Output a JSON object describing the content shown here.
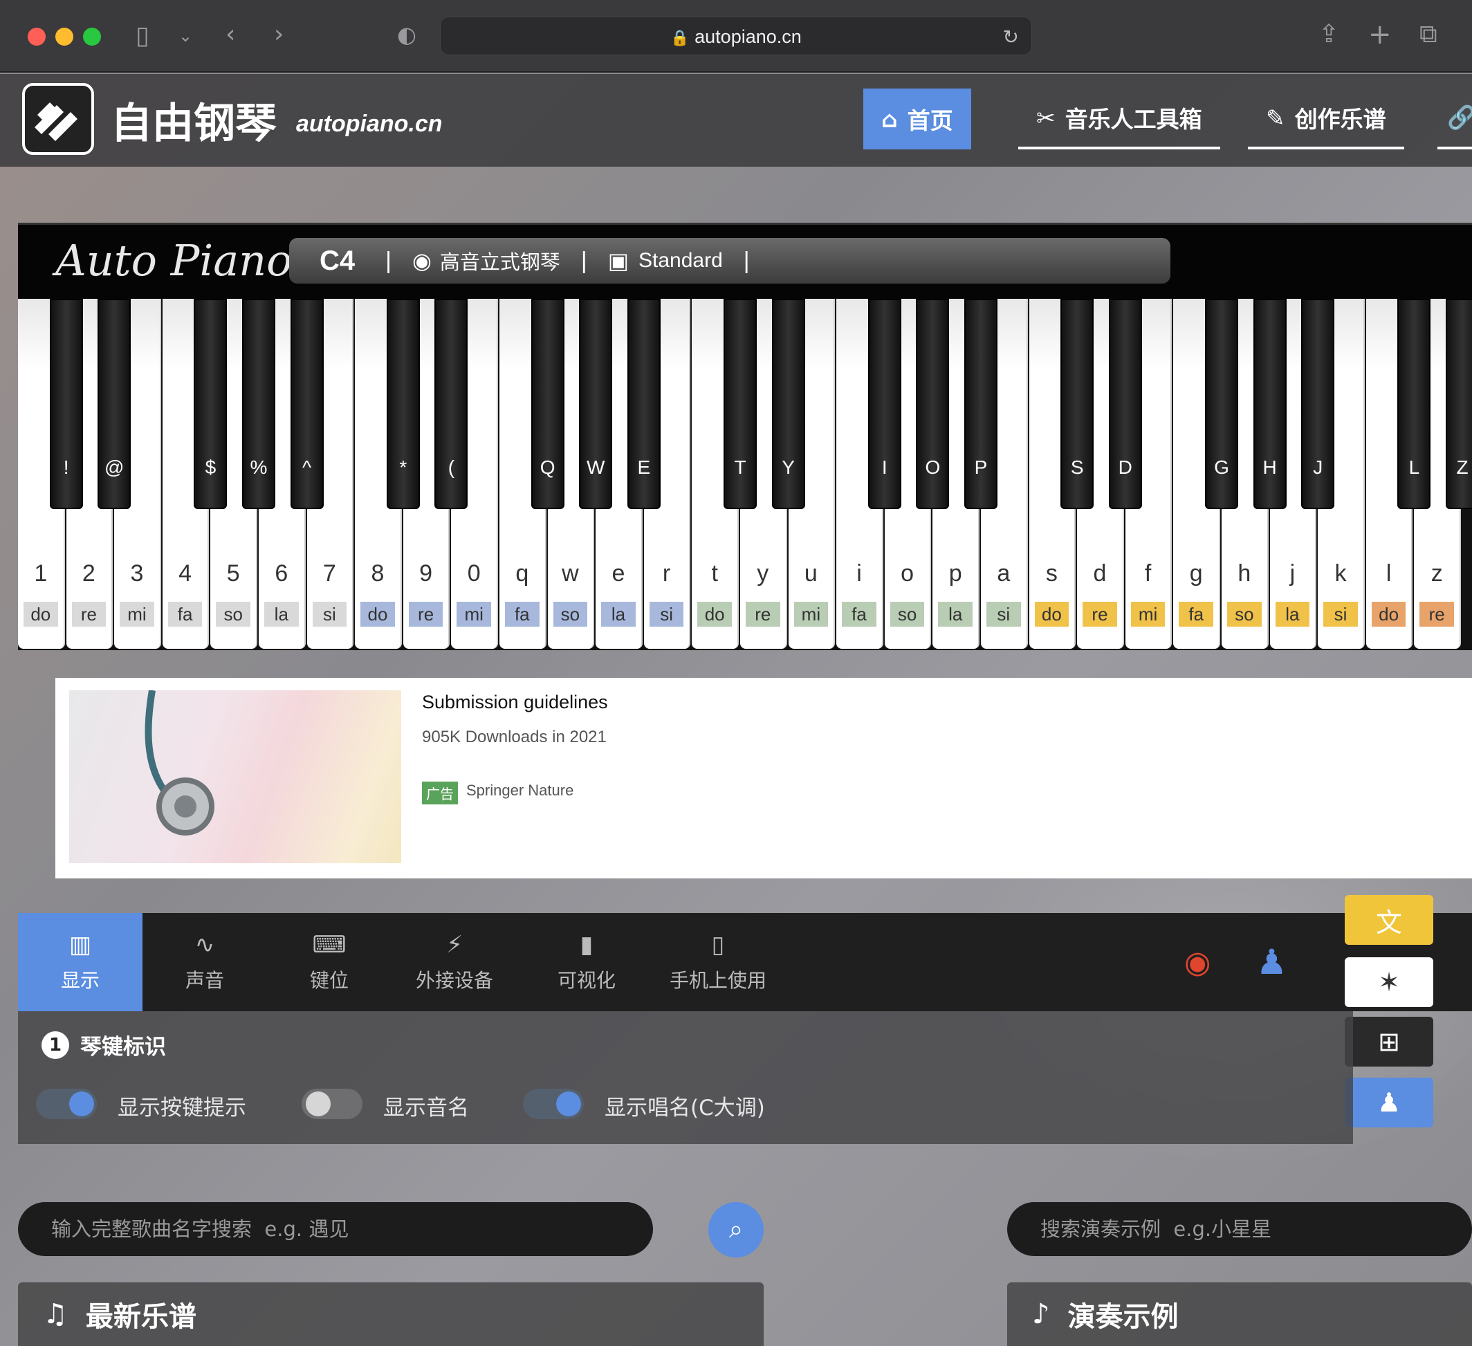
{
  "browser": {
    "url": "autopiano.cn"
  },
  "header": {
    "brand": "自由钢琴",
    "brand_sub": "autopiano.cn",
    "nav": [
      {
        "label": "首页",
        "icon": "home-icon"
      },
      {
        "label": "音乐人工具箱",
        "icon": "tools-icon"
      },
      {
        "label": "创作乐谱",
        "icon": "compose-icon"
      }
    ]
  },
  "piano": {
    "logo": "Auto Piano",
    "octave": "C4",
    "separator": "|",
    "instrument": "高音立式钢琴",
    "layout": "Standard",
    "white_keys": [
      {
        "k": "1",
        "s": "do",
        "c": "#d9d9d9"
      },
      {
        "k": "2",
        "s": "re",
        "c": "#d9d9d9"
      },
      {
        "k": "3",
        "s": "mi",
        "c": "#d9d9d9"
      },
      {
        "k": "4",
        "s": "fa",
        "c": "#d9d9d9"
      },
      {
        "k": "5",
        "s": "so",
        "c": "#d9d9d9"
      },
      {
        "k": "6",
        "s": "la",
        "c": "#d9d9d9"
      },
      {
        "k": "7",
        "s": "si",
        "c": "#d9d9d9"
      },
      {
        "k": "8",
        "s": "do",
        "c": "#a7b8dc"
      },
      {
        "k": "9",
        "s": "re",
        "c": "#a7b8dc"
      },
      {
        "k": "0",
        "s": "mi",
        "c": "#a7b8dc"
      },
      {
        "k": "q",
        "s": "fa",
        "c": "#a7b8dc"
      },
      {
        "k": "w",
        "s": "so",
        "c": "#a7b8dc"
      },
      {
        "k": "e",
        "s": "la",
        "c": "#a7b8dc"
      },
      {
        "k": "r",
        "s": "si",
        "c": "#a7b8dc"
      },
      {
        "k": "t",
        "s": "do",
        "c": "#b9cdb4"
      },
      {
        "k": "y",
        "s": "re",
        "c": "#b9cdb4"
      },
      {
        "k": "u",
        "s": "mi",
        "c": "#b9cdb4"
      },
      {
        "k": "i",
        "s": "fa",
        "c": "#b9cdb4"
      },
      {
        "k": "o",
        "s": "so",
        "c": "#b9cdb4"
      },
      {
        "k": "p",
        "s": "la",
        "c": "#b9cdb4"
      },
      {
        "k": "a",
        "s": "si",
        "c": "#b9cdb4"
      },
      {
        "k": "s",
        "s": "do",
        "c": "#f0c24a"
      },
      {
        "k": "d",
        "s": "re",
        "c": "#f0c24a"
      },
      {
        "k": "f",
        "s": "mi",
        "c": "#f0c24a"
      },
      {
        "k": "g",
        "s": "fa",
        "c": "#f0c24a"
      },
      {
        "k": "h",
        "s": "so",
        "c": "#f0c24a"
      },
      {
        "k": "j",
        "s": "la",
        "c": "#f0c24a"
      },
      {
        "k": "k",
        "s": "si",
        "c": "#f0c24a"
      },
      {
        "k": "l",
        "s": "do",
        "c": "#e8a36a"
      },
      {
        "k": "z",
        "s": "re",
        "c": "#e8a36a"
      }
    ],
    "black_keys": [
      {
        "k": "!",
        "after": 0
      },
      {
        "k": "@",
        "after": 1
      },
      {
        "k": "$",
        "after": 3
      },
      {
        "k": "%",
        "after": 4
      },
      {
        "k": "^",
        "after": 5
      },
      {
        "k": "*",
        "after": 7
      },
      {
        "k": "(",
        "after": 8
      },
      {
        "k": "Q",
        "after": 10
      },
      {
        "k": "W",
        "after": 11
      },
      {
        "k": "E",
        "after": 12
      },
      {
        "k": "T",
        "after": 14
      },
      {
        "k": "Y",
        "after": 15
      },
      {
        "k": "I",
        "after": 17
      },
      {
        "k": "O",
        "after": 18
      },
      {
        "k": "P",
        "after": 19
      },
      {
        "k": "S",
        "after": 21
      },
      {
        "k": "D",
        "after": 22
      },
      {
        "k": "G",
        "after": 24
      },
      {
        "k": "H",
        "after": 25
      },
      {
        "k": "J",
        "after": 26
      },
      {
        "k": "L",
        "after": 28
      },
      {
        "k": "Z",
        "after": 29
      }
    ]
  },
  "ad": {
    "title": "Submission guidelines",
    "subtitle": "905K Downloads in 2021",
    "tag": "广告",
    "advertiser": "Springer Nature"
  },
  "tabs": [
    {
      "label": "显示",
      "icon": "piano-icon"
    },
    {
      "label": "声音",
      "icon": "waveform-icon"
    },
    {
      "label": "键位",
      "icon": "keyboard-icon"
    },
    {
      "label": "外接设备",
      "icon": "plug-icon"
    },
    {
      "label": "可视化",
      "icon": "bar-chart-icon"
    },
    {
      "label": "手机上使用",
      "icon": "phone-icon"
    }
  ],
  "display_panel": {
    "section_number": "1",
    "section_title": "琴键标识",
    "toggles": [
      {
        "label": "显示按键提示",
        "on": true
      },
      {
        "label": "显示音名",
        "on": false
      },
      {
        "label": "显示唱名(C大调)",
        "on": true
      }
    ]
  },
  "search": {
    "song_placeholder": "输入完整歌曲名字搜索  e.g. 遇见",
    "demo_placeholder": "搜索演奏示例  e.g.小星星"
  },
  "cards": {
    "latest": "最新乐谱",
    "demos": "演奏示例"
  },
  "colors": {
    "accent": "#5b8de0",
    "translate": "#f0c53a"
  }
}
